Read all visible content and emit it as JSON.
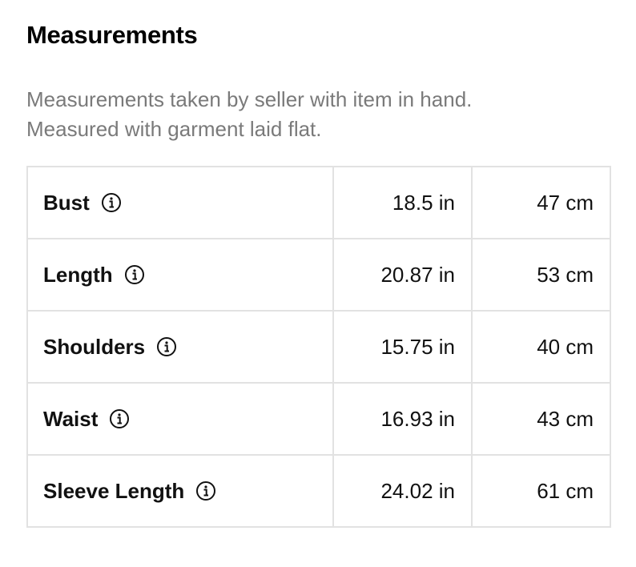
{
  "header": {
    "title": "Measurements"
  },
  "description": {
    "line1": "Measurements taken by seller with item in hand.",
    "line2": "Measured with garment laid flat."
  },
  "measurements": [
    {
      "label": "Bust",
      "inches": "18.5 in",
      "cm": "47 cm"
    },
    {
      "label": "Length",
      "inches": "20.87 in",
      "cm": "53 cm"
    },
    {
      "label": "Shoulders",
      "inches": "15.75 in",
      "cm": "40 cm"
    },
    {
      "label": "Waist",
      "inches": "16.93 in",
      "cm": "43 cm"
    },
    {
      "label": "Sleeve Length",
      "inches": "24.02 in",
      "cm": "61 cm"
    }
  ],
  "icons": {
    "info": "info-icon"
  },
  "colors": {
    "title": "#000000",
    "subtitle": "#7a7a7a",
    "border": "#e2e2e2"
  }
}
